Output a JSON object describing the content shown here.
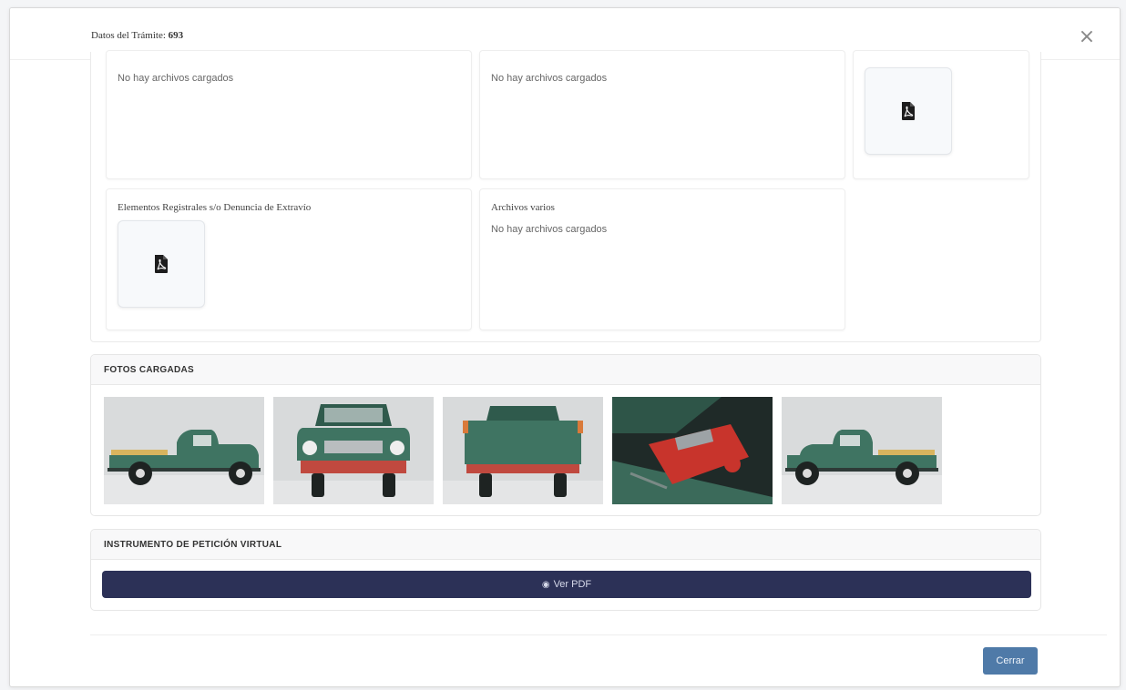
{
  "modal": {
    "title_prefix": "Datos del Trámite:",
    "title_number": "693",
    "close_symbol": "×"
  },
  "documents": {
    "cards": [
      {
        "title": "",
        "empty_text": "No hay archivos cargados",
        "has_file": false
      },
      {
        "title": "",
        "empty_text": "No hay archivos cargados",
        "has_file": false
      },
      {
        "title": "",
        "empty_text": "",
        "has_file": true,
        "icon": "pdf-file-icon"
      },
      {
        "title": "Elementos Registrales s/o Denuncia de Extravío",
        "empty_text": "",
        "has_file": true,
        "icon": "pdf-file-icon"
      },
      {
        "title": "Archivos varios",
        "empty_text": "No hay archivos cargados",
        "has_file": false
      }
    ]
  },
  "photos": {
    "header": "FOTOS CARGADAS",
    "items": [
      {
        "view": "side-left"
      },
      {
        "view": "front"
      },
      {
        "view": "rear"
      },
      {
        "view": "engine"
      },
      {
        "view": "side-left"
      }
    ]
  },
  "petition": {
    "header": "INSTRUMENTO DE PETICIÓN VIRTUAL",
    "eye_icon": "eye-icon",
    "button_label": "Ver PDF"
  },
  "footer": {
    "close_label": "Cerrar"
  },
  "colors": {
    "truck_green": "#3f7462",
    "bumper_red": "#c0493f",
    "pdf_button": "#2c3157",
    "close_button": "#4f7aa8"
  }
}
